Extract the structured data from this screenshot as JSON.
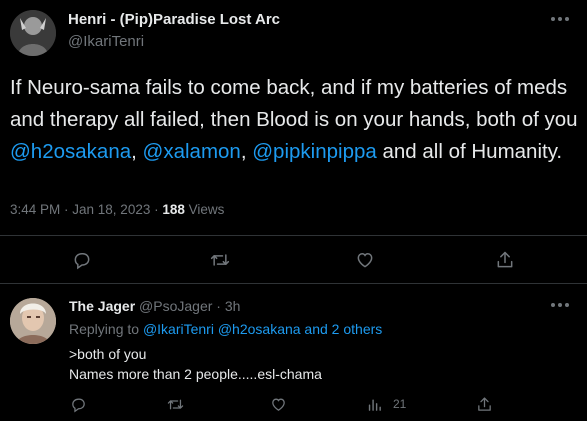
{
  "tweet": {
    "display_name": "Henri - (Pip)Paradise Lost Arc",
    "handle": "@IkariTenri",
    "text_part1": "If Neuro-sama fails to come back, and if my batteries of meds and therapy all failed, then Blood is on your hands, both of you ",
    "mention1": "@h2osakana",
    "sep1": ", ",
    "mention2": "@xalamon",
    "sep2": ", ",
    "mention3": "@pipkinpippa",
    "text_part2": " and all of Humanity.",
    "time": "3:44 PM · Jan 18, 2023 · ",
    "views_count": "188",
    "views_label": " Views",
    "icons": [
      "more-icon",
      "reply-icon",
      "retweet-icon",
      "like-icon",
      "share-icon"
    ]
  },
  "reply": {
    "display_name": "The Jager",
    "handle_time": " @PsoJager · 3h",
    "replying_prefix": "Replying to ",
    "replying_mentions": "@IkariTenri @h2osakana and 2 others",
    "line1": ">both of you",
    "line2": "Names more than 2 people.....esl-chama",
    "views_count": "21",
    "icons": [
      "more-icon",
      "reply-icon",
      "retweet-icon",
      "like-icon",
      "views-icon",
      "share-icon"
    ]
  },
  "colors": {
    "background": "#000000",
    "text": "#e7e9ea",
    "secondary": "#71767b",
    "link": "#1d9bf0",
    "divider": "#2f3336"
  }
}
